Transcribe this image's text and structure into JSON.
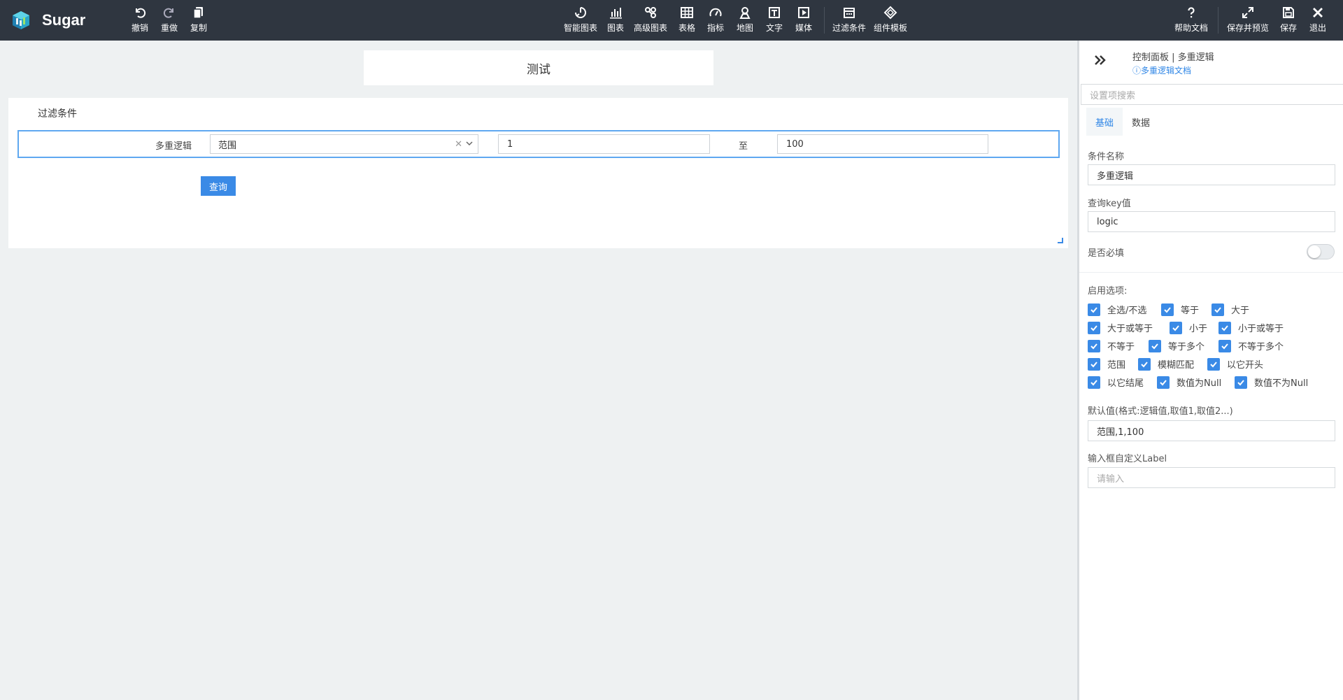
{
  "app": {
    "name": "Sugar"
  },
  "toolbar": {
    "left": [
      {
        "label": "撤销",
        "icon": "undo-icon"
      },
      {
        "label": "重做",
        "icon": "redo-icon"
      },
      {
        "label": "复制",
        "icon": "copy-icon"
      }
    ],
    "center": [
      {
        "label": "智能图表",
        "icon": "smart-chart-icon"
      },
      {
        "label": "图表",
        "icon": "bar-chart-icon"
      },
      {
        "label": "高级图表",
        "icon": "advanced-chart-icon"
      },
      {
        "label": "表格",
        "icon": "table-icon"
      },
      {
        "label": "指标",
        "icon": "gauge-icon"
      },
      {
        "label": "地图",
        "icon": "map-pin-icon"
      },
      {
        "label": "文字",
        "icon": "text-icon"
      },
      {
        "label": "媒体",
        "icon": "media-icon"
      },
      {
        "label": "过滤条件",
        "icon": "filter-calendar-icon"
      },
      {
        "label": "组件模板",
        "icon": "template-icon"
      }
    ],
    "right": [
      {
        "label": "帮助文档",
        "icon": "help-icon"
      },
      {
        "label": "保存并预览",
        "icon": "expand-icon"
      },
      {
        "label": "保存",
        "icon": "save-icon"
      },
      {
        "label": "退出",
        "icon": "close-icon"
      }
    ]
  },
  "canvas": {
    "title": "测试",
    "filter": {
      "title": "过滤条件",
      "row_label": "多重逻辑",
      "select_value": "范围",
      "from_value": "1",
      "to_label": "至",
      "to_value": "100",
      "query_button": "查询"
    }
  },
  "panel": {
    "breadcrumb": "控制面板 | 多重逻辑",
    "doc_link": "多重逻辑文档",
    "search_placeholder": "设置项搜索",
    "tabs": [
      {
        "label": "基础",
        "active": true
      },
      {
        "label": "数据",
        "active": false
      }
    ],
    "condition_name_label": "条件名称",
    "condition_name_value": "多重逻辑",
    "query_key_label": "查询key值",
    "query_key_value": "logic",
    "required_label": "是否必填",
    "required_on": false,
    "options_label": "启用选项:",
    "options": [
      {
        "label": "全选/不选",
        "checked": true
      },
      {
        "label": "等于",
        "checked": true
      },
      {
        "label": "大于",
        "checked": true
      },
      {
        "label": "大于或等于",
        "checked": true
      },
      {
        "label": "小于",
        "checked": true
      },
      {
        "label": "小于或等于",
        "checked": true
      },
      {
        "label": "不等于",
        "checked": true
      },
      {
        "label": "等于多个",
        "checked": true
      },
      {
        "label": "不等于多个",
        "checked": true
      },
      {
        "label": "范围",
        "checked": true
      },
      {
        "label": "模糊匹配",
        "checked": true
      },
      {
        "label": "以它开头",
        "checked": true
      },
      {
        "label": "以它结尾",
        "checked": true
      },
      {
        "label": "数值为Null",
        "checked": true
      },
      {
        "label": "数值不为Null",
        "checked": true
      }
    ],
    "default_label": "默认值(格式:逻辑值,取值1,取值2...)",
    "default_value": "范围,1,100",
    "custom_label_label": "输入框自定义Label",
    "custom_label_placeholder": "请输入"
  },
  "colors": {
    "topbar": "#2f3640",
    "accent": "#3a8ae6",
    "link": "#2f86e6",
    "canvas_bg": "#eef1f2"
  }
}
